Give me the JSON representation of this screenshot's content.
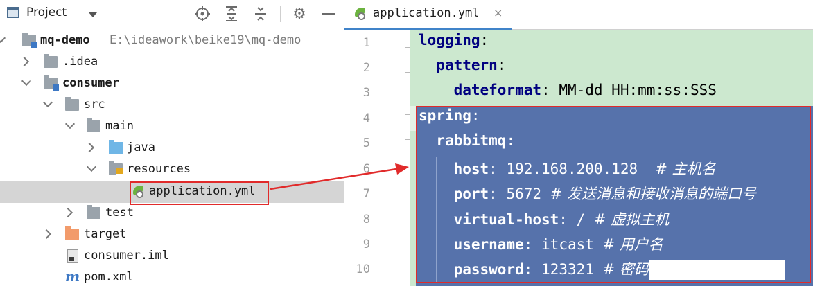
{
  "project_panel": {
    "title": "Project",
    "tree": [
      {
        "label": "mq-demo",
        "path": "E:\\ideawork\\beike19\\mq-demo"
      },
      {
        "label": ".idea"
      },
      {
        "label": "consumer"
      },
      {
        "label": "src"
      },
      {
        "label": "main"
      },
      {
        "label": "java"
      },
      {
        "label": "resources"
      },
      {
        "label": "application.yml"
      },
      {
        "label": "test"
      },
      {
        "label": "target"
      },
      {
        "label": "consumer.iml"
      },
      {
        "label": "pom.xml"
      }
    ]
  },
  "editor": {
    "tab_title": "application.yml",
    "tab_close": "×",
    "line_numbers": [
      "1",
      "2",
      "3",
      "4",
      "5",
      "6",
      "7",
      "8",
      "9",
      "10"
    ],
    "lines": [
      {
        "key": "logging",
        "value": "",
        "comment": ""
      },
      {
        "key": "pattern",
        "value": "",
        "comment": ""
      },
      {
        "key": "dateformat",
        "value": "MM-dd HH:mm:ss:SSS",
        "comment": ""
      },
      {
        "key": "spring",
        "value": "",
        "comment": ""
      },
      {
        "key": "rabbitmq",
        "value": "",
        "comment": ""
      },
      {
        "key": "host",
        "value": "192.168.200.128",
        "comment": "# 主机名"
      },
      {
        "key": "port",
        "value": "5672",
        "comment": "# 发送消息和接收消息的端口号"
      },
      {
        "key": "virtual-host",
        "value": "/",
        "comment": "# 虚拟主机"
      },
      {
        "key": "username",
        "value": "itcast",
        "comment": "# 用户名"
      },
      {
        "key": "password",
        "value": "123321",
        "comment": "# 密码"
      }
    ]
  },
  "colors": {
    "selection": "#5672ab",
    "yaml_bg": "#cce8cf",
    "annotation": "#e12b2b",
    "key": "#000080"
  }
}
